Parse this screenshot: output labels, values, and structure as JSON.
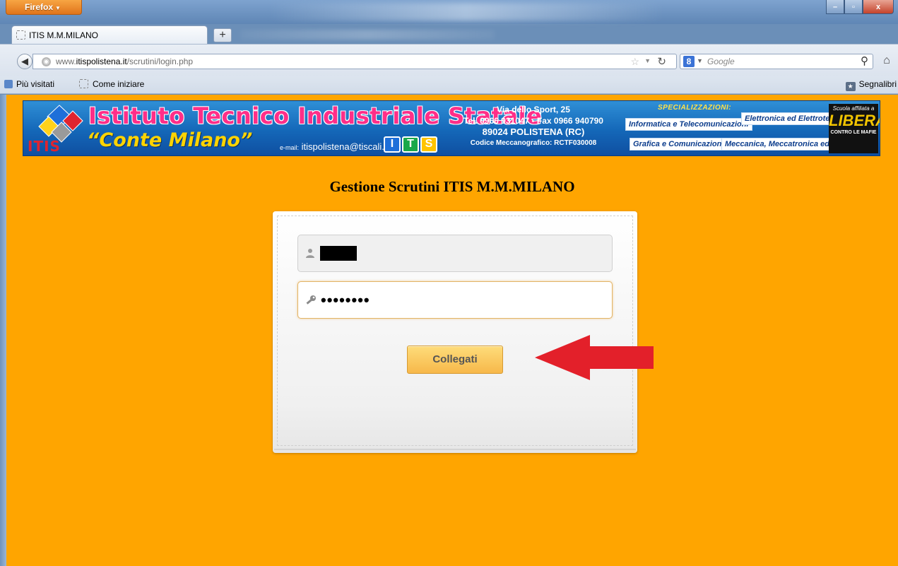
{
  "browser": {
    "menu_button": "Firefox",
    "window_controls": {
      "minimize": "–",
      "maximize": "▫",
      "close": "x"
    },
    "tab": {
      "title": "ITIS M.M.MILANO"
    },
    "new_tab": "+",
    "url": {
      "prefix": "www.",
      "host": "itispolistena.it",
      "path": "/scrutini/login.php"
    },
    "search": {
      "engine_letter": "8",
      "placeholder": "Google"
    },
    "bookmarks": {
      "most_visited": "Più visitati",
      "getting_started": "Come iniziare",
      "bookmarks": "Segnalibri"
    }
  },
  "banner": {
    "title_line1": "Istituto Tecnico Industriale Statale",
    "title_line2": "“Conte Milano”",
    "logo_text": "ITIS",
    "email_label": "e-mail:",
    "email": "itispolistena@tiscali.it",
    "its_letters": [
      "I",
      "T",
      "S"
    ],
    "address": "Via dello Sport, 25",
    "phone": "Tel. 0966 931047 - Fax 0966 940790",
    "city": "89024 POLISTENA (RC)",
    "code": "Codice Meccanografico: RCTF030008",
    "spec_heading": "SPECIALIZZAZIONI:",
    "specs": [
      "Informatica e Telecomunicazioni",
      "Elettronica ed Elettrotecnica",
      "Grafica e Comunicazione",
      "Meccanica, Meccatronica ed Energia"
    ],
    "libera": {
      "top": "Scuola affiliata a",
      "brand": "LIBERA",
      "bottom": "CONTRO LE MAFIE"
    }
  },
  "page": {
    "heading": "Gestione Scrutini ITIS M.M.MILANO"
  },
  "login": {
    "password_mask": "••••••••",
    "submit_label": "Collegati"
  },
  "colors": {
    "page_background": "#ffa500",
    "button_gradient_top": "#fedc7a",
    "button_gradient_bottom": "#f7b84a",
    "annotation_arrow": "#e3202a"
  }
}
